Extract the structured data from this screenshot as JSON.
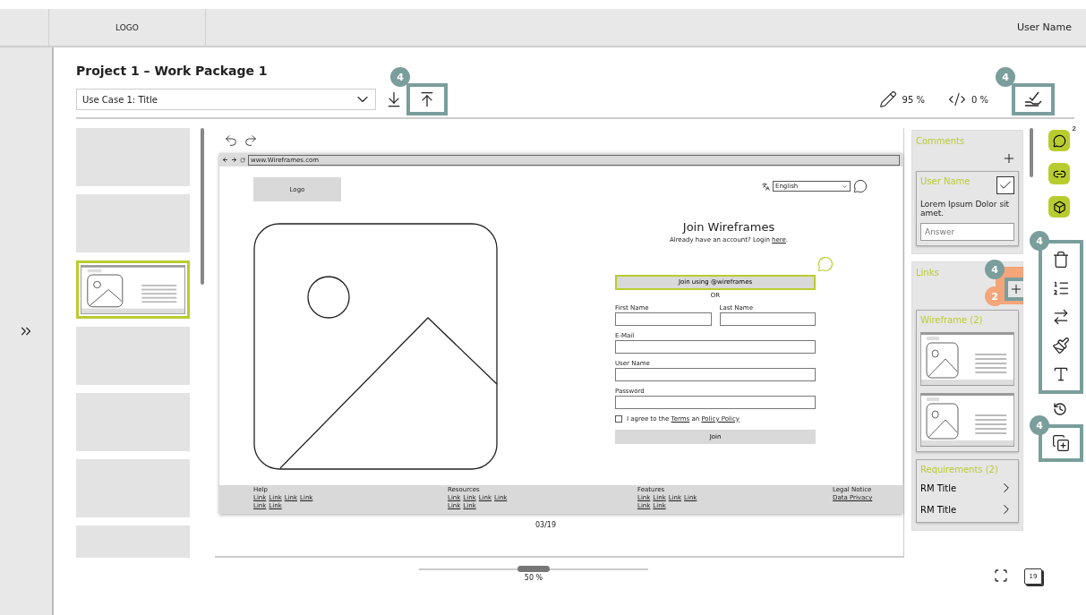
{
  "header": {
    "logo": "LOGO",
    "user_name": "User Name"
  },
  "project": {
    "title": "Project 1 – Work Package 1",
    "use_case": "Use Case 1: Title",
    "upload_badge": {
      "label": "4",
      "color": "#7a9e9c"
    },
    "approve_badge": {
      "label": "4",
      "color": "#7a9e9c"
    },
    "stats": [
      {
        "kind": "edit",
        "value": "95 %"
      },
      {
        "kind": "code",
        "value": "0 %"
      }
    ]
  },
  "thumbnails": [
    {
      "selected": false
    },
    {
      "selected": false
    },
    {
      "selected": true
    },
    {
      "selected": false
    },
    {
      "selected": false
    },
    {
      "selected": false
    },
    {
      "selected": false
    }
  ],
  "mockup": {
    "url": "www.Wireframes.com",
    "logo": "Logo",
    "language": "English",
    "heading": "Join Wireframes",
    "login_prompt": "Already have an account? Login",
    "login_link": "here",
    "login_end": ".",
    "sso_button": "Join using @wireframes",
    "or": "OR",
    "name_fields": [
      {
        "label": "First Name"
      },
      {
        "label": "Last Name"
      }
    ],
    "fields": [
      {
        "label": "E-Mail"
      },
      {
        "label": "User Name"
      },
      {
        "label": "Password"
      }
    ],
    "agree": {
      "checked": false,
      "text": "I agree to the",
      "terms": "Terms",
      "and": "an",
      "policy": "Policy Policy"
    },
    "join_button": "Join",
    "footer": [
      {
        "title": "Help",
        "links": [
          "Link",
          "Link",
          "Link",
          "Link",
          "Link",
          "Link"
        ]
      },
      {
        "title": "Resources",
        "links": [
          "Link",
          "Link",
          "Link",
          "Link",
          "Link",
          "Link"
        ]
      },
      {
        "title": "Features",
        "links": [
          "Link",
          "Link",
          "Link",
          "Link",
          "Link",
          "Link"
        ]
      },
      {
        "title": "Legal Notice",
        "links": [
          "Data Privacy"
        ]
      }
    ]
  },
  "page_indicator": "03/19",
  "zoom": {
    "level": 0.5,
    "reading": "50 %"
  },
  "pages_badge": "19",
  "comments": {
    "title": "Comments",
    "items": [
      {
        "author": "User Name",
        "checked": true,
        "text": "Lorem Ipsum Dolor sit amet.",
        "placeholder": "Answer"
      }
    ]
  },
  "links": {
    "title": "Links",
    "add_badges": [
      {
        "label": "4",
        "color": "#7a9e9c"
      },
      {
        "label": "2",
        "color": "#f4a57a"
      }
    ],
    "wireframe_group": "Wireframe (2)",
    "wireframe_previews": [
      {
        "kind": "wireframe"
      },
      {
        "kind": "wireframe"
      }
    ],
    "requirements_group": "Requirements (2)",
    "requirements": [
      "RM Title",
      "RM Title"
    ]
  },
  "tools": [
    {
      "kind": "comment",
      "badge": "2"
    },
    {
      "kind": "link"
    },
    {
      "kind": "cube"
    }
  ],
  "edit_tools": {
    "badge": {
      "label": "4",
      "color": "#7a9e9c"
    },
    "items": [
      {
        "kind": "delete"
      },
      {
        "kind": "list"
      },
      {
        "kind": "swap"
      },
      {
        "kind": "style"
      },
      {
        "kind": "text"
      }
    ]
  },
  "duplicate_badge": {
    "label": "4",
    "color": "#7a9e9c"
  }
}
